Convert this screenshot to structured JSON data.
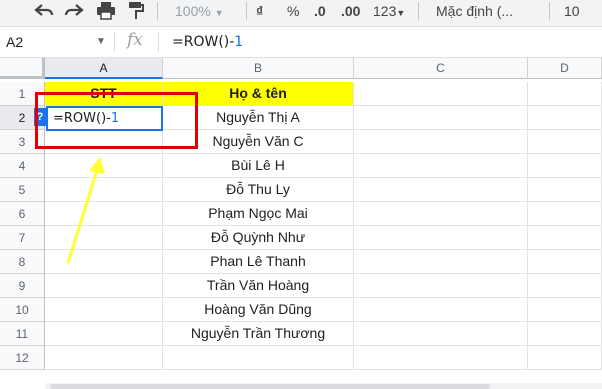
{
  "toolbar": {
    "zoom": "100%",
    "currency": "₫",
    "percent": "%",
    "dec_decrease": ".0",
    "dec_increase": ".00",
    "more_formats": "123",
    "font": "Mặc định (...",
    "font_size": "10"
  },
  "formula_bar": {
    "cell_ref": "A2",
    "fx": "fx",
    "formula_main": "=ROW()-",
    "formula_num": "1"
  },
  "columns": [
    "A",
    "B",
    "C",
    "D"
  ],
  "rows": [
    "1",
    "2",
    "3",
    "4",
    "5",
    "6",
    "7",
    "8",
    "9",
    "10",
    "11",
    "12"
  ],
  "table": {
    "header_a": "STT",
    "header_b": "Họ & tên",
    "names": [
      "Nguyễn Thị A",
      "Nguyễn Văn C",
      "Bùi Lê H",
      "Đỗ Thu Ly",
      "Phạm Ngọc Mai",
      "Đỗ Quỳnh Như",
      "Phan Lê Thanh",
      "Trần Văn Hoàng",
      "Hoàng Văn Dũng",
      "Nguyễn Trần Thương"
    ]
  },
  "editor": {
    "formula_main": "=ROW()-",
    "formula_num": "1",
    "help_badge": "?"
  },
  "colors": {
    "header_fill": "#ffff00",
    "annotation_red": "#e00000",
    "annotation_arrow": "#ffff33",
    "selection_blue": "#1a73e8"
  }
}
